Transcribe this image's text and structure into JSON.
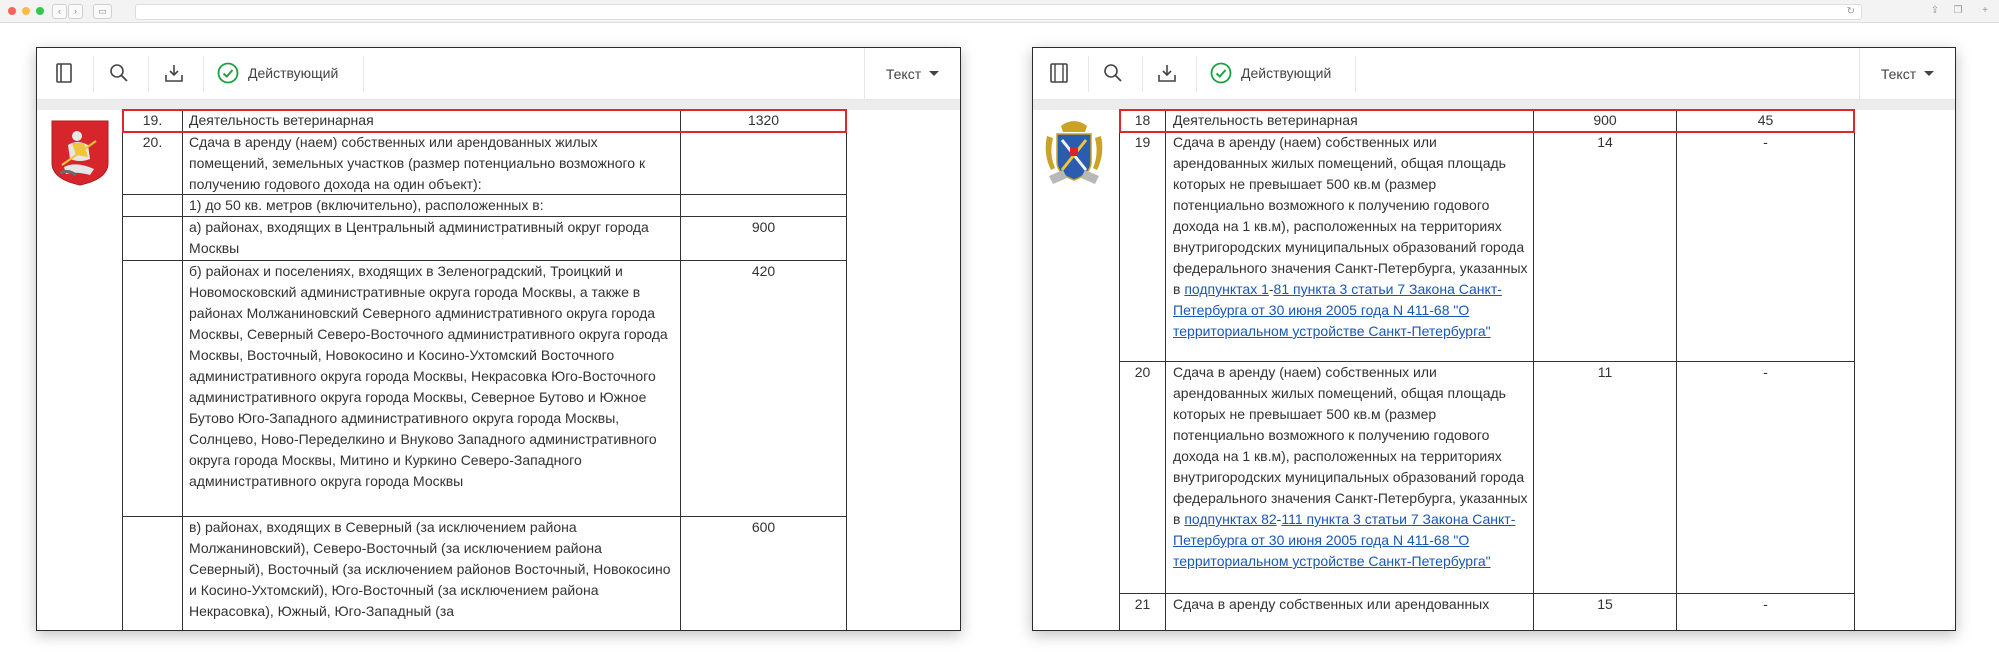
{
  "left_panel": {
    "toolbar": {
      "status_label": "Действующий",
      "doc_type": "Текст"
    },
    "coat_of_arms": "moscow-coat-of-arms",
    "rows": [
      {
        "num": "19.",
        "text": "Деятельность ветеринарная",
        "value": "1320"
      },
      {
        "num": "20.",
        "text": "Сдача в аренду (наем) собственных или арендованных жилых помещений, земельных участков (размер потенциально возможного к получению годового дохода на один объект):",
        "value": ""
      },
      {
        "num": "",
        "text": "1) до 50 кв. метров (включительно), расположенных в:",
        "value": ""
      },
      {
        "num": "",
        "text": "а) районах, входящих в Центральный административный округ города Москвы",
        "value": "900"
      },
      {
        "num": "",
        "text": "б) районах и поселениях, входящих в Зеленоградский, Троицкий и Новомосковский административные округа города Москвы, а также в районах Молжаниновский Северного административного округа города Москвы, Северный Северо-Восточного административного округа города Москвы, Восточный, Новокосино и Косино-Ухтомский Восточного административного округа города Москвы, Некрасовка Юго-Восточного административного округа города Москвы, Северное Бутово и Южное Бутово Юго-Западного административного округа города Москвы, Солнцево, Ново-Переделкино и Внуково Западного административного округа города Москвы, Митино и Куркино Северо-Западного административного округа города Москвы",
        "value": "420"
      },
      {
        "num": "",
        "text": "в) районах, входящих в Северный (за исключением района Молжаниновский), Северо-Восточный (за исключением района Северный), Восточный (за исключением районов Восточный, Новокосино и Косино-Ухтомский), Юго-Восточный (за исключением района Некрасовка), Южный, Юго-Западный (за",
        "value": "600"
      }
    ]
  },
  "right_panel": {
    "toolbar": {
      "status_label": "Действующий",
      "doc_type": "Текст"
    },
    "coat_of_arms": "saint-petersburg-coat-of-arms",
    "rows": [
      {
        "num": "18",
        "text": "Деятельность ветеринарная",
        "value1": "900",
        "value2": "45"
      },
      {
        "num": "19",
        "text_before": "Сдача в аренду (наем) собственных или арендованных жилых помещений, общая площадь которых не превышает 500 кв.м (размер потенциально возможного к получению годового дохода на 1 кв.м), расположенных на территориях внутригородских муниципальных образований города федерального значения Санкт-Петербурга, указанных в ",
        "link1": "подпунктах 1",
        "dash": "-",
        "link2": "81 пункта 3 статьи 7 Закона Санкт-Петербурга от 30 июня 2005 года N 411-68 \"О территориальном устройстве Санкт-Петербурга\"",
        "value1": "14",
        "value2": "-"
      },
      {
        "num": "20",
        "text_before": "Сдача в аренду (наем) собственных или арендованных жилых помещений, общая площадь которых не превышает 500 кв.м (размер потенциально возможного к получению годового дохода на 1 кв.м), расположенных на территориях внутригородских муниципальных образований города федерального значения Санкт-Петербурга, указанных в ",
        "link1": "подпунктах 82",
        "dash": "-",
        "link2": "111 пункта 3 статьи 7 Закона Санкт-Петербурга от 30 июня 2005 года N 411-68 \"О территориальном устройстве Санкт-Петербурга\"",
        "value1": "11",
        "value2": "-"
      },
      {
        "num": "21",
        "text": "Сдача в аренду собственных или арендованных",
        "value1": "15",
        "value2": "-"
      }
    ]
  }
}
